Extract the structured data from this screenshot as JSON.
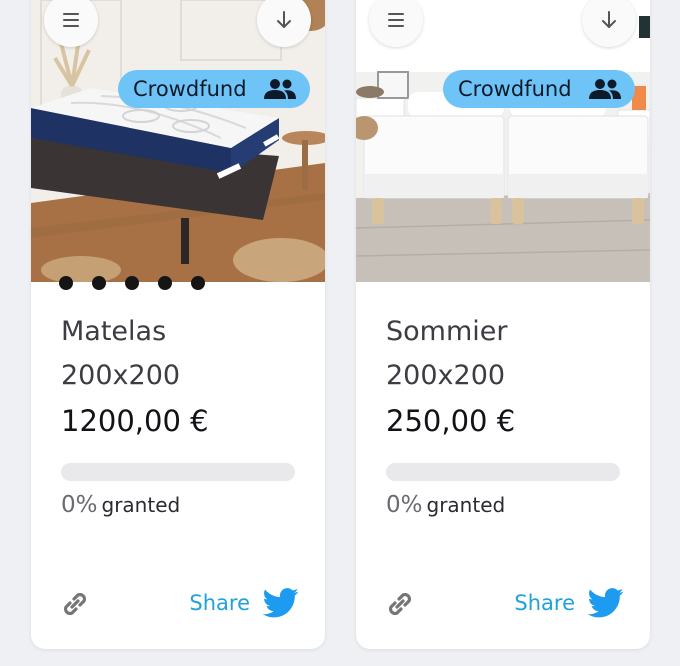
{
  "cards": [
    {
      "badge_label": "Crowdfund",
      "title": "Matelas",
      "size": "200x200",
      "price": "1200,00 €",
      "progress_percent": "0%",
      "progress_word": "granted",
      "progress_fraction": 0,
      "share_label": "Share",
      "image_dots": 5
    },
    {
      "badge_label": "Crowdfund",
      "title": "Sommier",
      "size": "200x200",
      "price": "250,00 €",
      "progress_percent": "0%",
      "progress_word": "granted",
      "progress_fraction": 0,
      "share_label": "Share",
      "image_dots": 0
    }
  ],
  "colors": {
    "badge": "#6ec4f6",
    "share": "#1fa2dc",
    "twitter": "#1d9bf0",
    "progress_track": "#e9e9ec"
  },
  "icons": {
    "menu": "menu-icon",
    "download": "arrow-down-icon",
    "group": "group-icon",
    "link": "link-icon",
    "twitter": "twitter-icon"
  }
}
